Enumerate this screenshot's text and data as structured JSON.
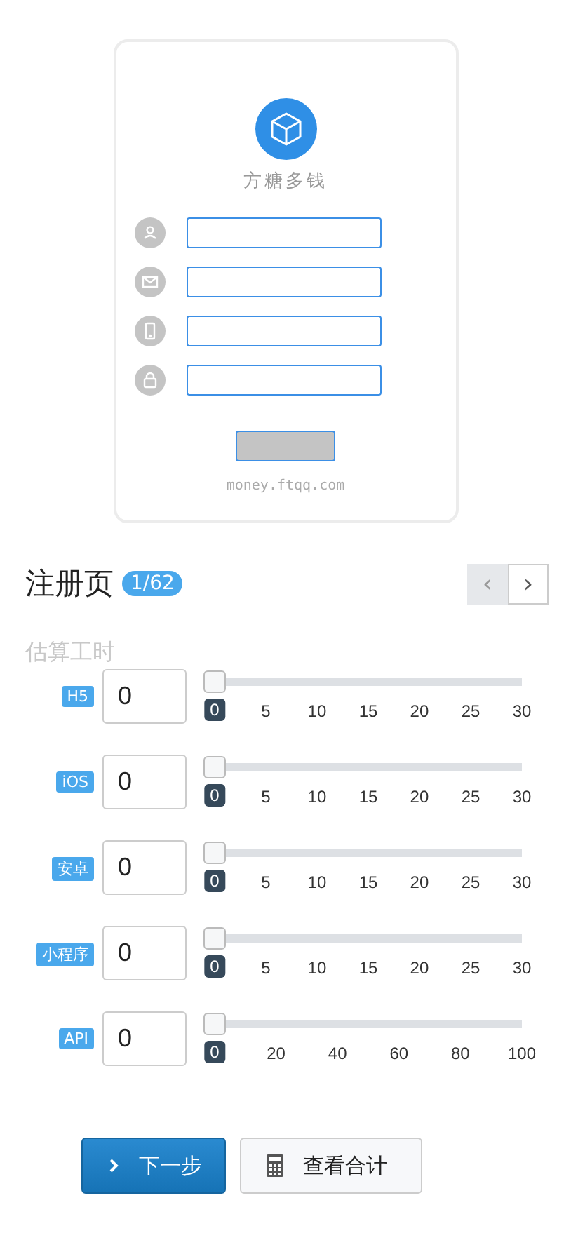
{
  "preview": {
    "brand": "方糖多钱",
    "fields": [
      {
        "kind": "user"
      },
      {
        "kind": "mail"
      },
      {
        "kind": "phone"
      },
      {
        "kind": "lock"
      }
    ],
    "footer": "money.ftqq.com"
  },
  "page": {
    "title": "注册页",
    "counter": "1/62",
    "pager": [
      {
        "label": "‹",
        "disabled": true
      },
      {
        "label": "›",
        "disabled": false
      }
    ]
  },
  "section": "估算工时",
  "estimates": [
    {
      "name": "H5",
      "value": "0",
      "level": 0,
      "value_label": "0",
      "ticks": [
        "5",
        "10",
        "15",
        "20",
        "25",
        "30"
      ]
    },
    {
      "name": "iOS",
      "value": "0",
      "level": 0,
      "value_label": "0",
      "ticks": [
        "5",
        "10",
        "15",
        "20",
        "25",
        "30"
      ]
    },
    {
      "name": "安卓",
      "value": "0",
      "level": 0,
      "value_label": "0",
      "ticks": [
        "5",
        "10",
        "15",
        "20",
        "25",
        "30"
      ]
    },
    {
      "name": "小程序",
      "value": "0",
      "level": 0,
      "value_label": "0",
      "ticks": [
        "5",
        "10",
        "15",
        "20",
        "25",
        "30"
      ]
    },
    {
      "name": "API",
      "value": "0",
      "level": 0,
      "value_label": "0",
      "ticks": [
        "20",
        "40",
        "60",
        "80",
        "100"
      ]
    }
  ],
  "buttons": {
    "next": "下一步",
    "total": "查看合计"
  }
}
